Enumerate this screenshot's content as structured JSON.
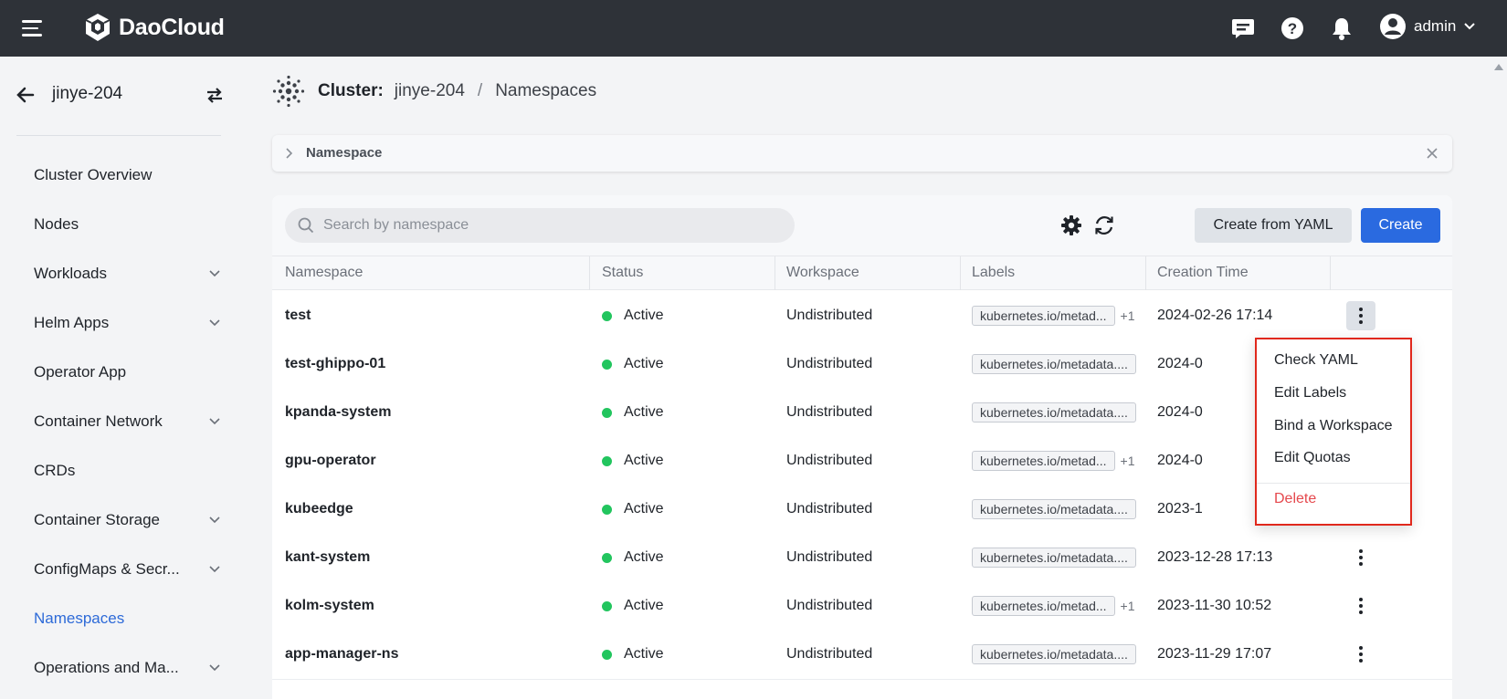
{
  "app": {
    "brand": "DaoCloud"
  },
  "header": {
    "user_name": "admin"
  },
  "sidebar": {
    "cluster_name": "jinye-204",
    "items": [
      {
        "label": "Cluster Overview",
        "expandable": false,
        "active": false
      },
      {
        "label": "Nodes",
        "expandable": false,
        "active": false
      },
      {
        "label": "Workloads",
        "expandable": true,
        "active": false
      },
      {
        "label": "Helm Apps",
        "expandable": true,
        "active": false
      },
      {
        "label": "Operator App",
        "expandable": false,
        "active": false
      },
      {
        "label": "Container Network",
        "expandable": true,
        "active": false
      },
      {
        "label": "CRDs",
        "expandable": false,
        "active": false
      },
      {
        "label": "Container Storage",
        "expandable": true,
        "active": false
      },
      {
        "label": "ConfigMaps & Secr...",
        "expandable": true,
        "active": false
      },
      {
        "label": "Namespaces",
        "expandable": false,
        "active": true
      },
      {
        "label": "Operations and Ma...",
        "expandable": true,
        "active": false
      }
    ]
  },
  "breadcrumb": {
    "label": "Cluster:",
    "cluster": "jinye-204",
    "separator": "/",
    "page": "Namespaces"
  },
  "namespace_bar": {
    "label": "Namespace"
  },
  "toolbar": {
    "search_placeholder": "Search by namespace",
    "create_from_yaml": "Create from YAML",
    "create": "Create"
  },
  "table": {
    "columns": [
      "Namespace",
      "Status",
      "Workspace",
      "Labels",
      "Creation Time"
    ],
    "rows": [
      {
        "name": "test",
        "status": "Active",
        "workspace": "Undistributed",
        "label": "kubernetes.io/metad...",
        "extra": "+1",
        "time": "2024-02-26 17:14"
      },
      {
        "name": "test-ghippo-01",
        "status": "Active",
        "workspace": "Undistributed",
        "label": "kubernetes.io/metadata....",
        "extra": "",
        "time": "2024-0"
      },
      {
        "name": "kpanda-system",
        "status": "Active",
        "workspace": "Undistributed",
        "label": "kubernetes.io/metadata....",
        "extra": "",
        "time": "2024-0"
      },
      {
        "name": "gpu-operator",
        "status": "Active",
        "workspace": "Undistributed",
        "label": "kubernetes.io/metad...",
        "extra": "+1",
        "time": "2024-0"
      },
      {
        "name": "kubeedge",
        "status": "Active",
        "workspace": "Undistributed",
        "label": "kubernetes.io/metadata....",
        "extra": "",
        "time": "2023-1"
      },
      {
        "name": "kant-system",
        "status": "Active",
        "workspace": "Undistributed",
        "label": "kubernetes.io/metadata....",
        "extra": "",
        "time": "2023-12-28 17:13"
      },
      {
        "name": "kolm-system",
        "status": "Active",
        "workspace": "Undistributed",
        "label": "kubernetes.io/metad...",
        "extra": "+1",
        "time": "2023-11-30 10:52"
      },
      {
        "name": "app-manager-ns",
        "status": "Active",
        "workspace": "Undistributed",
        "label": "kubernetes.io/metadata....",
        "extra": "",
        "time": "2023-11-29 17:07"
      }
    ]
  },
  "menu": {
    "items": [
      "Check YAML",
      "Edit Labels",
      "Bind a Workspace",
      "Edit Quotas"
    ],
    "danger": "Delete"
  },
  "colors": {
    "topbar": "#2e3238",
    "primary": "#2a6ae0",
    "active_nav": "#2d6ad8",
    "status_active": "#22c55e",
    "danger": "#e5484d",
    "highlight_border": "#e0281c"
  }
}
